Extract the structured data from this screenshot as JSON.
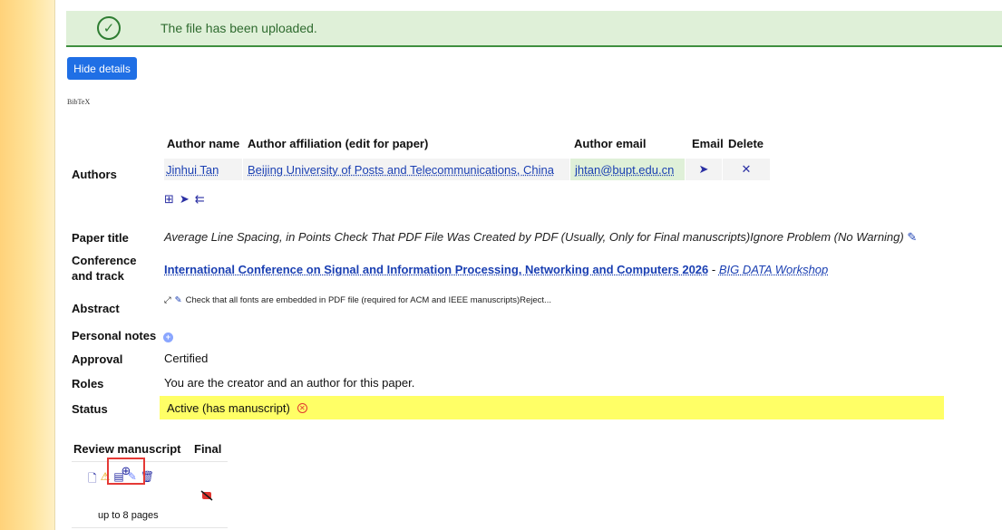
{
  "alert": {
    "message": "The file has been uploaded."
  },
  "controls": {
    "hide_details": "Hide details",
    "bibtex": "BibTeX"
  },
  "authors": {
    "section_label": "Authors",
    "headers": [
      "Author name",
      "Author affiliation (edit for paper)",
      "Author email",
      "Email",
      "Delete"
    ],
    "rows": [
      {
        "name": "Jinhui Tan",
        "affiliation": "Beijing University of Posts and Telecommunications, China",
        "email": "jhtan@bupt.edu.cn"
      }
    ]
  },
  "paper": {
    "title_label": "Paper title",
    "title_value": "Average Line Spacing, in Points Check That PDF File Was Created by PDF (Usually, Only for Final manuscripts)Ignore Problem (No Warning)",
    "conference_label_line1": "Conference",
    "conference_label_line2": "and track",
    "conference_name": "International Conference on Signal and Information Processing, Networking and Computers 2026",
    "track_name": "BIG DATA Workshop",
    "abstract_label": "Abstract",
    "abstract_text": "Check that all fonts are embedded in PDF file (required for ACM and IEEE manuscripts)Reject...",
    "notes_label": "Personal notes",
    "approval_label": "Approval",
    "approval_value": "Certified",
    "roles_label": "Roles",
    "roles_value": "You are the creator and an author for this paper.",
    "status_label": "Status",
    "status_value": "Active (has manuscript)"
  },
  "manuscript": {
    "headers": [
      "Review manuscript",
      "Final"
    ],
    "pages_note": "up to 8 pages"
  },
  "colors": {
    "link": "#1a3fb2",
    "button": "#1f6fe5",
    "status_bg": "#ffff66",
    "success_bg": "#dff0d8"
  }
}
